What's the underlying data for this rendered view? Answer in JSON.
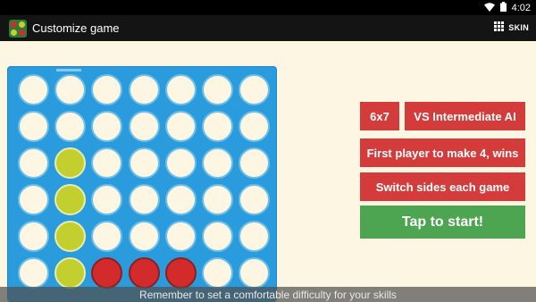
{
  "status_bar": {
    "time": "4:02",
    "wifi_icon": "wifi-icon",
    "battery_icon": "battery-icon"
  },
  "app_bar": {
    "title": "Customize game",
    "skin_label": "SKIN",
    "app_icon": "connect-four-app-icon",
    "skin_icon": "grid-icon"
  },
  "board": {
    "rows": 6,
    "cols": 7,
    "cells": [
      [
        "empty",
        "empty",
        "empty",
        "empty",
        "empty",
        "empty",
        "empty"
      ],
      [
        "empty",
        "empty",
        "empty",
        "empty",
        "empty",
        "empty",
        "empty"
      ],
      [
        "empty",
        "yellow",
        "empty",
        "empty",
        "empty",
        "empty",
        "empty"
      ],
      [
        "empty",
        "yellow",
        "empty",
        "empty",
        "empty",
        "empty",
        "empty"
      ],
      [
        "empty",
        "yellow",
        "empty",
        "empty",
        "empty",
        "empty",
        "empty"
      ],
      [
        "empty",
        "yellow",
        "red",
        "red",
        "red",
        "empty",
        "empty"
      ]
    ],
    "colors": {
      "board": "#2a9bdc",
      "empty": "#fdf6e2",
      "yellow": "#c3cf2e",
      "red": "#d32b2b"
    }
  },
  "options": {
    "size_label": "6x7",
    "opponent_label": "VS Intermediate AI",
    "win_rule_label": "First player to make 4, wins",
    "sides_label": "Switch sides each game",
    "start_label": "Tap to start!"
  },
  "toast": {
    "message": "Remember to set a comfortable difficulty for your skills"
  },
  "colors": {
    "accent_red": "#d43c3c",
    "accent_green": "#4da451",
    "background": "#fdf6e2"
  }
}
